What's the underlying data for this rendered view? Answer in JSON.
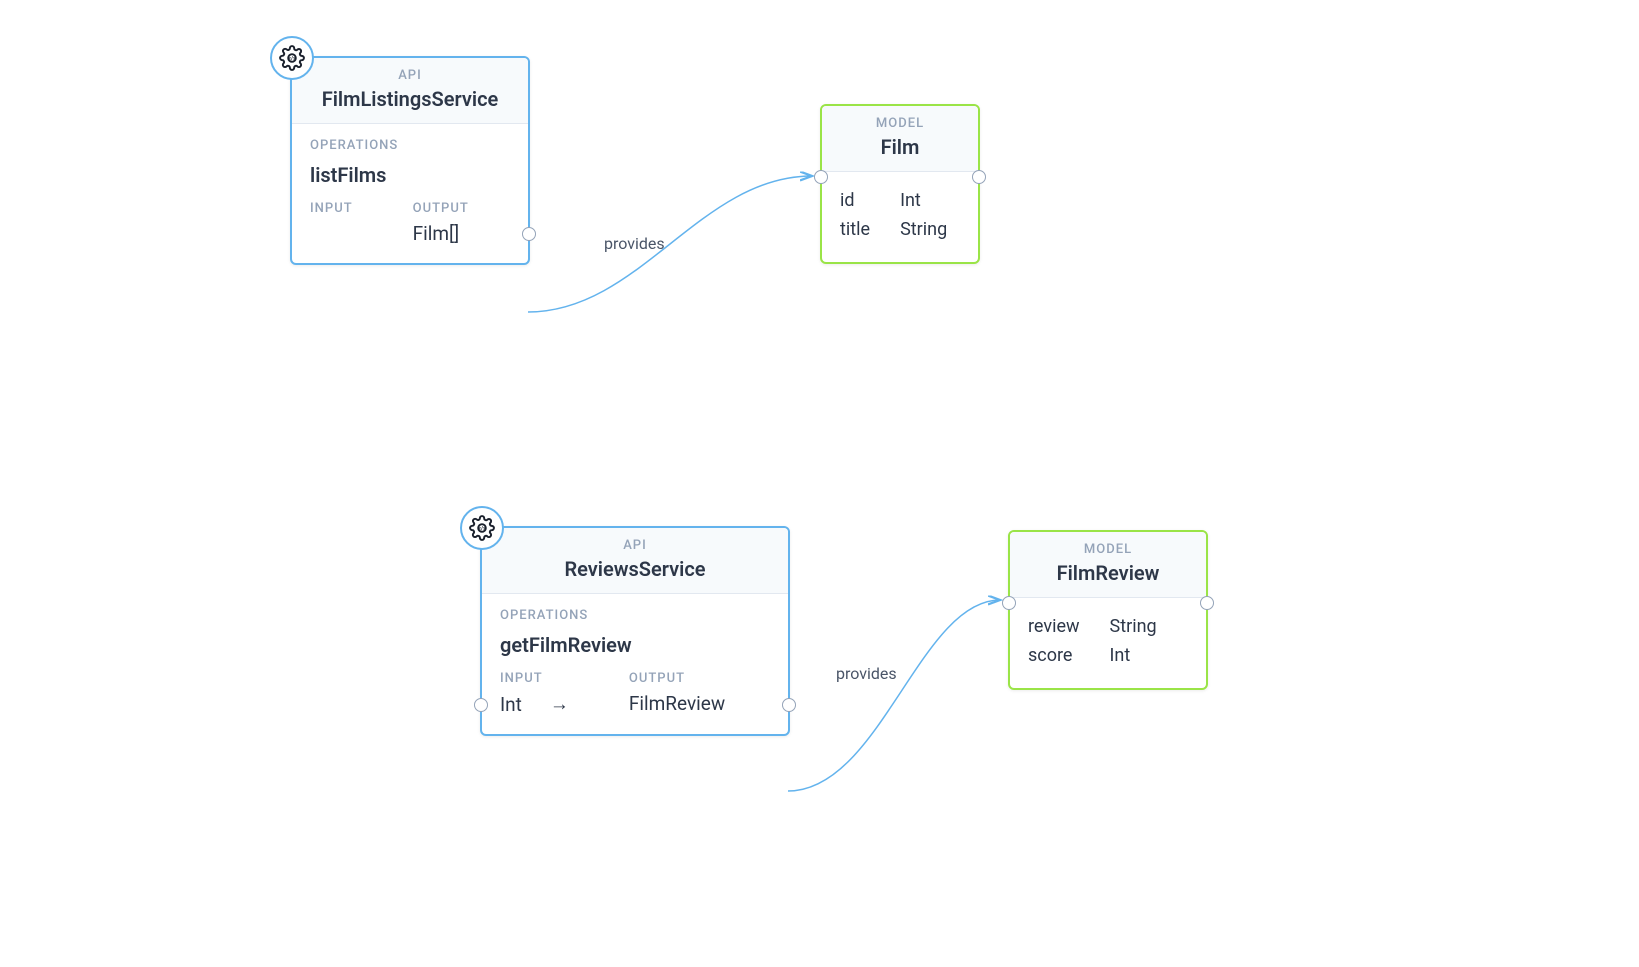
{
  "nodes": {
    "api1": {
      "kind": "API",
      "title": "FilmListingsService",
      "sectionLabel": "OPERATIONS",
      "operation": "listFilms",
      "inputLabel": "INPUT",
      "outputLabel": "OUTPUT",
      "inputValue": "",
      "outputValue": "Film[]"
    },
    "model1": {
      "kind": "MODEL",
      "title": "Film",
      "fields": [
        {
          "name": "id",
          "type": "Int"
        },
        {
          "name": "title",
          "type": "String"
        }
      ]
    },
    "api2": {
      "kind": "API",
      "title": "ReviewsService",
      "sectionLabel": "OPERATIONS",
      "operation": "getFilmReview",
      "inputLabel": "INPUT",
      "outputLabel": "OUTPUT",
      "inputValue": "Int",
      "outputValue": "FilmReview",
      "arrow": "→"
    },
    "model2": {
      "kind": "MODEL",
      "title": "FilmReview",
      "fields": [
        {
          "name": "review",
          "type": "String"
        },
        {
          "name": "score",
          "type": "Int"
        }
      ]
    }
  },
  "edges": {
    "e1label": "provides",
    "e2label": "provides"
  },
  "colors": {
    "apiBorder": "#63b3ed",
    "modelBorder": "#9ae447",
    "edge": "#63b3ed"
  }
}
